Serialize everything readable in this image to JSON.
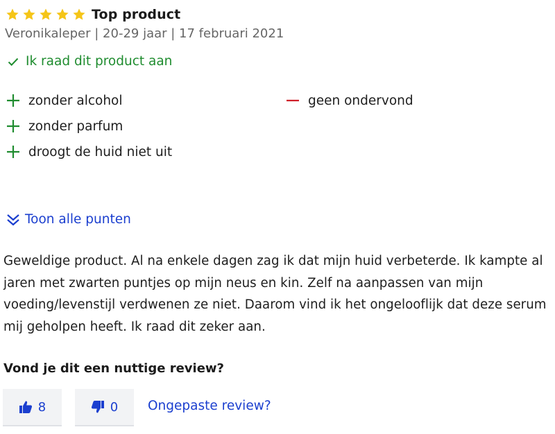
{
  "review": {
    "rating": 5,
    "max_rating": 5,
    "title": "Top product",
    "meta": "Veronikaleper | 20-29 jaar | 17 februari 2021",
    "recommend_text": "Ik raad dit product aan",
    "pros": [
      "zonder alcohol",
      "zonder parfum",
      "droogt de huid niet uit"
    ],
    "cons": [
      "geen ondervond"
    ],
    "show_all_label": "Toon alle punten",
    "body": "Geweldige product. Al na enkele dagen zag ik dat mijn huid verbeterde. Ik kampte al jaren met zwarten puntjes op mijn neus en kin. Zelf na aanpassen van mijn voeding/levenstijl verdwenen ze niet. Daarom vind ik het ongelooflijk dat deze serum mij geholpen heeft. Ik raad dit zeker aan.",
    "helpful_question": "Vond je dit een nuttige review?",
    "votes_up": "8",
    "votes_down": "0",
    "report_label": "Ongepaste review?"
  },
  "icons": {
    "star": "star-icon",
    "check": "check-icon",
    "plus": "plus-icon",
    "minus": "minus-icon",
    "chevrons": "double-chevron-down-icon",
    "thumbs_up": "thumbs-up-icon",
    "thumbs_down": "thumbs-down-icon"
  },
  "colors": {
    "star": "#f5c518",
    "positive": "#1f8c2f",
    "negative": "#d0202a",
    "link": "#1b3fcf",
    "meta": "#666666",
    "vote_bg": "#f2f3f5"
  }
}
